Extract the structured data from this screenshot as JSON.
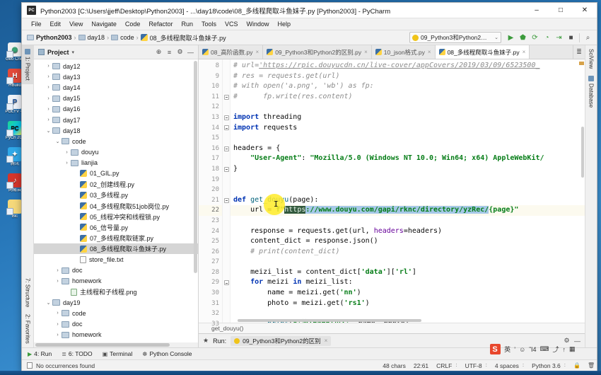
{
  "window": {
    "title": "Python2003 [C:\\Users\\jjeff\\Desktop\\Python2003] - ...\\day18\\code\\08_多线程爬取斗鱼妹子.py [Python2003] - PyCharm",
    "app_icon": "pycharm-icon",
    "minimize": "–",
    "maximize": "□",
    "close": "✕"
  },
  "menu": {
    "items": [
      "File",
      "Edit",
      "View",
      "Navigate",
      "Code",
      "Refactor",
      "Run",
      "Tools",
      "VCS",
      "Window",
      "Help"
    ]
  },
  "navbar": {
    "breadcrumbs": [
      {
        "label": "Python2003",
        "icon": "folder-icon",
        "bold": true
      },
      {
        "label": "day18",
        "icon": "folder-icon",
        "bold": false
      },
      {
        "label": "code",
        "icon": "folder-icon",
        "bold": false
      },
      {
        "label": "08_多线程爬取斗鱼妹子.py",
        "icon": "python-file-icon",
        "bold": false
      }
    ],
    "separator": "›",
    "run_config": "09_Python3和Python2的区别",
    "run_config_caret": "⌄",
    "buttons": [
      {
        "name": "run-button",
        "glyph": "▶"
      },
      {
        "name": "debug-button",
        "glyph": "⬟"
      },
      {
        "name": "run-coverage-button",
        "glyph": "⟳"
      },
      {
        "name": "profile-button",
        "glyph": "◔"
      },
      {
        "name": "run-with-console-button",
        "glyph": "⇥"
      },
      {
        "name": "stop-button",
        "glyph": "■"
      },
      {
        "name": "search-everywhere-button",
        "glyph": "⌕"
      }
    ]
  },
  "left_strip": {
    "top": [
      "1: Project"
    ],
    "bottom": [
      "2: Favorites",
      "7: Structure"
    ]
  },
  "right_strip": {
    "items": [
      "SciView",
      "Database"
    ]
  },
  "project_panel": {
    "title": "Project",
    "caret": "▾",
    "header_buttons": [
      {
        "name": "locate-button",
        "glyph": "⊕"
      },
      {
        "name": "collapse-all-button",
        "glyph": "≡"
      },
      {
        "name": "settings-gear-button",
        "glyph": "⚙"
      },
      {
        "name": "hide-panel-button",
        "glyph": "—"
      }
    ],
    "tree": [
      {
        "label": "day12",
        "type": "folder",
        "indent": 1,
        "arrow": "›",
        "selected": false
      },
      {
        "label": "day13",
        "type": "folder",
        "indent": 1,
        "arrow": "›",
        "selected": false
      },
      {
        "label": "day14",
        "type": "folder",
        "indent": 1,
        "arrow": "›",
        "selected": false
      },
      {
        "label": "day15",
        "type": "folder",
        "indent": 1,
        "arrow": "›",
        "selected": false
      },
      {
        "label": "day16",
        "type": "folder",
        "indent": 1,
        "arrow": "›",
        "selected": false
      },
      {
        "label": "day17",
        "type": "folder",
        "indent": 1,
        "arrow": "›",
        "selected": false
      },
      {
        "label": "day18",
        "type": "folder",
        "indent": 1,
        "arrow": "⌄",
        "selected": false
      },
      {
        "label": "code",
        "type": "folder",
        "indent": 2,
        "arrow": "⌄",
        "selected": false
      },
      {
        "label": "douyu",
        "type": "folder",
        "indent": 3,
        "arrow": "›",
        "selected": false
      },
      {
        "label": "lianjia",
        "type": "folder",
        "indent": 3,
        "arrow": "›",
        "selected": false
      },
      {
        "label": "01_GIL.py",
        "type": "py",
        "indent": 4,
        "arrow": "",
        "selected": false
      },
      {
        "label": "02_创建线程.py",
        "type": "py",
        "indent": 4,
        "arrow": "",
        "selected": false
      },
      {
        "label": "03_多线程.py",
        "type": "py",
        "indent": 4,
        "arrow": "",
        "selected": false
      },
      {
        "label": "04_多线程爬取51job岗位.py",
        "type": "py",
        "indent": 4,
        "arrow": "",
        "selected": false
      },
      {
        "label": "05_线程冲突和线程锁.py",
        "type": "py",
        "indent": 4,
        "arrow": "",
        "selected": false
      },
      {
        "label": "06_信号量.py",
        "type": "py",
        "indent": 4,
        "arrow": "",
        "selected": false
      },
      {
        "label": "07_多线程爬取链家.py",
        "type": "py",
        "indent": 4,
        "arrow": "",
        "selected": false
      },
      {
        "label": "08_多线程爬取斗鱼妹子.py",
        "type": "py",
        "indent": 4,
        "arrow": "",
        "selected": true
      },
      {
        "label": "store_file.txt",
        "type": "txt",
        "indent": 4,
        "arrow": "",
        "selected": false
      },
      {
        "label": "doc",
        "type": "folder",
        "indent": 2,
        "arrow": "›",
        "selected": false
      },
      {
        "label": "homework",
        "type": "folder",
        "indent": 2,
        "arrow": "›",
        "selected": false
      },
      {
        "label": "主线程和子线程.png",
        "type": "png",
        "indent": 3,
        "arrow": "",
        "selected": false
      },
      {
        "label": "day19",
        "type": "folder",
        "indent": 1,
        "arrow": "⌄",
        "selected": false
      },
      {
        "label": "code",
        "type": "folder",
        "indent": 2,
        "arrow": "›",
        "selected": false
      },
      {
        "label": "doc",
        "type": "folder",
        "indent": 2,
        "arrow": "›",
        "selected": false
      },
      {
        "label": "homework",
        "type": "folder",
        "indent": 2,
        "arrow": "›",
        "selected": false
      }
    ]
  },
  "editor": {
    "tabs": [
      {
        "label": "08_高阶函数.py",
        "active": false
      },
      {
        "label": "09_Python3和Python2的区别.py",
        "active": false
      },
      {
        "label": "10_json格式.py",
        "active": false
      },
      {
        "label": "08_多线程爬取斗鱼妹子.py",
        "active": true
      }
    ],
    "tab_close": "×",
    "tab_list_button": "≣",
    "first_line_number": 8,
    "current_line": 22,
    "line_numbers": [
      8,
      9,
      10,
      11,
      12,
      13,
      14,
      15,
      16,
      17,
      18,
      19,
      20,
      21,
      22,
      23,
      24,
      25,
      26,
      27,
      28,
      29,
      30,
      31,
      32,
      33
    ],
    "code_lines": [
      "# url='https://rpic.douyucdn.cn/live-cover/appCovers/2019/03/09/6523500_",
      "# res = requests.get(url)",
      "# with open('a.png', 'wb') as fp:",
      "#      fp.write(res.content)",
      "",
      "import threading",
      "import requests",
      "",
      "headers = {",
      "    \"User-Agent\": \"Mozilla/5.0 (Windows NT 10.0; Win64; x64) AppleWebKit/",
      "}",
      "",
      "",
      "def get_douyu(page):",
      "    url = f\"https://www.douyu.com/gapi/rknc/directory/yzRec/{page}\"",
      "",
      "    response = requests.get(url, headers=headers)",
      "    content_dict = response.json()",
      "    # print(content_dict)",
      "",
      "    meizi_list = content_dict['data']['rl']",
      "    for meizi in meizi_list:",
      "        name = meizi.get('nn')",
      "        photo = meizi.get('rs1')",
      "",
      "        print(f'第{page}页:', name, photo)"
    ],
    "selection_text": "https://www.douyu.com/gapi/rknc/directory/yzRec/",
    "selection_highlight_word": "https",
    "breadcrumb_footer": "get_douyu()"
  },
  "run_window": {
    "star_icon": "★",
    "label": "Run:",
    "tab_label": "09_Python3和Python2的区别",
    "tab_close": "×",
    "settings_icon": "⚙",
    "hide_icon": "—"
  },
  "bottom_strip": {
    "items": [
      {
        "label": "4: Run",
        "icon": "▶",
        "green": true
      },
      {
        "label": "6: TODO",
        "icon": "≣",
        "green": false
      },
      {
        "label": "Terminal",
        "icon": "▣",
        "green": false
      },
      {
        "label": "Python Console",
        "icon": "☸",
        "green": false
      }
    ]
  },
  "status_bar": {
    "message": "No occurrences found",
    "cells": [
      {
        "label": "48 chars",
        "sep": ""
      },
      {
        "label": "22:61",
        "sep": ""
      },
      {
        "label": "CRLF",
        "sep": "∶"
      },
      {
        "label": "UTF-8",
        "sep": "∶"
      },
      {
        "label": "4 spaces",
        "sep": "∶"
      },
      {
        "label": "Python 3.6",
        "sep": "∶"
      }
    ],
    "lock_icon": "ὑ2",
    "trash_icon": "Ὕ1"
  },
  "ime_widget": {
    "logo": "S",
    "items": [
      "英",
      "’",
      "☺",
      "Ἲ4",
      "⌨",
      "⤴",
      "↑",
      "▦"
    ]
  },
  "desktop_icons": [
    {
      "label": "Google Chro...",
      "short": "Geo\nChro",
      "color": "#e8e8e8",
      "glyph": "◯"
    },
    {
      "label": "HBuilder",
      "short": "HBuild",
      "color": "#e24a3a",
      "glyph": "H"
    },
    {
      "label": "POLYV 手机",
      "short": "POLYV\n手",
      "color": "#e9eef5",
      "glyph": "P"
    },
    {
      "label": "PyCharm 201",
      "short": "PyCh\n201",
      "color": "#2f8f3f",
      "glyph": "PC"
    },
    {
      "label": "腾讯",
      "short": "腾讯",
      "color": "#2fa8e8",
      "glyph": "❖"
    },
    {
      "label": "网易云",
      "short": "网易云",
      "color": "#d5352b",
      "glyph": "♪"
    },
    {
      "label": "Blc",
      "short": "Blc",
      "color": "#f5d87a",
      "glyph": ""
    }
  ]
}
